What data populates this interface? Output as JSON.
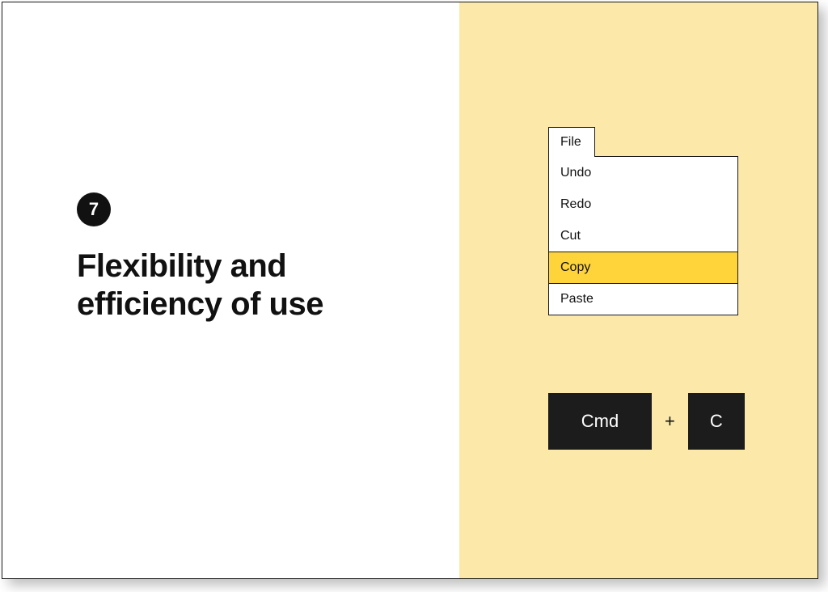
{
  "badge": "7",
  "title_line1": "Flexibility and",
  "title_line2": "efficiency of use",
  "menu": {
    "tab": "File",
    "items": [
      "Undo",
      "Redo",
      "Cut",
      "Copy",
      "Paste"
    ],
    "highlighted": "Copy"
  },
  "shortcut": {
    "key1": "Cmd",
    "plus": "+",
    "key2": "C"
  },
  "colors": {
    "panel_bg": "#fce9a9",
    "highlight": "#ffd43b",
    "key_bg": "#1c1c1c",
    "border": "#1a1a1a"
  }
}
